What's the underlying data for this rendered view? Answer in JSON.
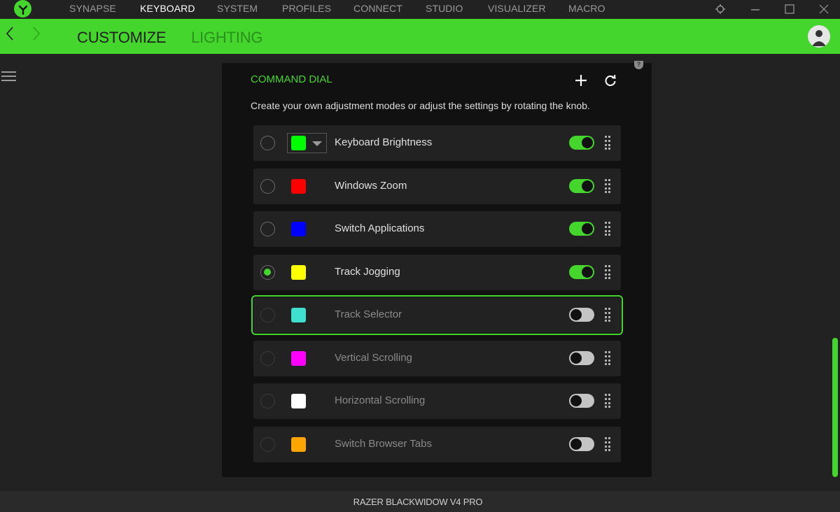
{
  "topnav": {
    "items": [
      {
        "label": "SYNAPSE",
        "active": false
      },
      {
        "label": "KEYBOARD",
        "active": true
      },
      {
        "label": "SYSTEM",
        "active": false
      },
      {
        "label": "PROFILES",
        "active": false
      },
      {
        "label": "CONNECT",
        "active": false
      },
      {
        "label": "STUDIO",
        "active": false
      },
      {
        "label": "VISUALIZER",
        "active": false
      },
      {
        "label": "MACRO",
        "active": false
      }
    ],
    "icons": [
      "razer-logo-icon",
      "settings-gear-icon",
      "minimize-icon",
      "maximize-icon",
      "close-icon"
    ]
  },
  "subnav": {
    "tabs": [
      {
        "label": "CUSTOMIZE",
        "active": true
      },
      {
        "label": "LIGHTING",
        "active": false
      }
    ]
  },
  "panel": {
    "title": "COMMAND DIAL",
    "description": "Create your own adjustment modes or adjust the settings by rotating the knob.",
    "add_label": "+",
    "reset_label": "reset",
    "help_label": "?"
  },
  "modes": [
    {
      "label": "Keyboard Brightness",
      "color": "#00ff00",
      "selected": false,
      "enabled": true,
      "has_dropdown": true
    },
    {
      "label": "Windows Zoom",
      "color": "#ff0000",
      "selected": false,
      "enabled": true
    },
    {
      "label": "Switch Applications",
      "color": "#0000ff",
      "selected": false,
      "enabled": true
    },
    {
      "label": "Track Jogging",
      "color": "#ffff00",
      "selected": true,
      "enabled": true
    },
    {
      "label": "Track Selector",
      "color": "#40e0d0",
      "selected": false,
      "enabled": false,
      "focused": true
    },
    {
      "label": "Vertical Scrolling",
      "color": "#ff00ff",
      "selected": false,
      "enabled": false
    },
    {
      "label": "Horizontal Scrolling",
      "color": "#ffffff",
      "selected": false,
      "enabled": false
    },
    {
      "label": "Switch Browser Tabs",
      "color": "#ffa500",
      "selected": false,
      "enabled": false
    }
  ],
  "footer": {
    "device_name": "RAZER BLACKWIDOW V4 PRO"
  },
  "colors": {
    "accent": "#44d62c",
    "background": "#222222",
    "panel": "#111111"
  }
}
